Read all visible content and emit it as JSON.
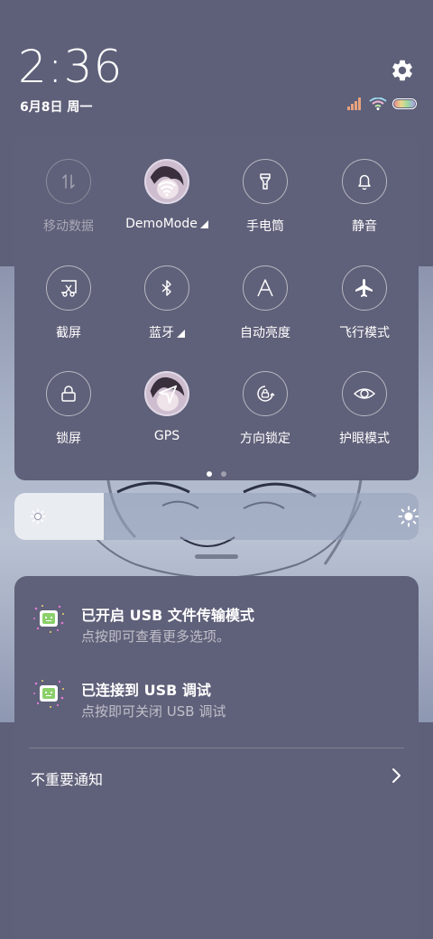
{
  "status": {
    "time": "2:36",
    "date": "6月8日 周一",
    "icons": [
      "signal-icon",
      "wifi-icon",
      "battery-icon"
    ]
  },
  "quick_settings": {
    "tiles": [
      {
        "label": "移动数据",
        "icon": "mobile-data-icon",
        "enabled": false
      },
      {
        "label": "DemoMode",
        "icon": "wifi-avatar-icon",
        "enabled": true,
        "expandable": true
      },
      {
        "label": "手电筒",
        "icon": "flashlight-icon",
        "enabled": true
      },
      {
        "label": "静音",
        "icon": "bell-icon",
        "enabled": true
      },
      {
        "label": "截屏",
        "icon": "screenshot-icon",
        "enabled": true
      },
      {
        "label": "蓝牙",
        "icon": "bluetooth-icon",
        "enabled": true,
        "expandable": true
      },
      {
        "label": "自动亮度",
        "icon": "auto-brightness-icon",
        "enabled": true
      },
      {
        "label": "飞行模式",
        "icon": "airplane-icon",
        "enabled": true
      },
      {
        "label": "锁屏",
        "icon": "lock-icon",
        "enabled": true
      },
      {
        "label": "GPS",
        "icon": "gps-avatar-icon",
        "enabled": true
      },
      {
        "label": "方向锁定",
        "icon": "rotation-lock-icon",
        "enabled": true
      },
      {
        "label": "护眼模式",
        "icon": "eye-icon",
        "enabled": true
      }
    ],
    "page_count": 2,
    "current_page": 1
  },
  "brightness": {
    "level": 0.22
  },
  "notifications": [
    {
      "title": "已开启 USB 文件传输模式",
      "subtitle": "点按即可查看更多选项。",
      "icon": "android-usb-icon"
    },
    {
      "title": "已连接到 USB 调试",
      "subtitle": "点按即可关闭 USB 调试",
      "icon": "android-usb-icon"
    }
  ],
  "unimportant": {
    "label": "不重要通知"
  },
  "colors": {
    "panel": "#5f6079",
    "background": "#5e6079",
    "brightness_fill": "#e9ecf1",
    "android_green": "#8bd06a",
    "sparkle_pink": "#e07ad8"
  }
}
